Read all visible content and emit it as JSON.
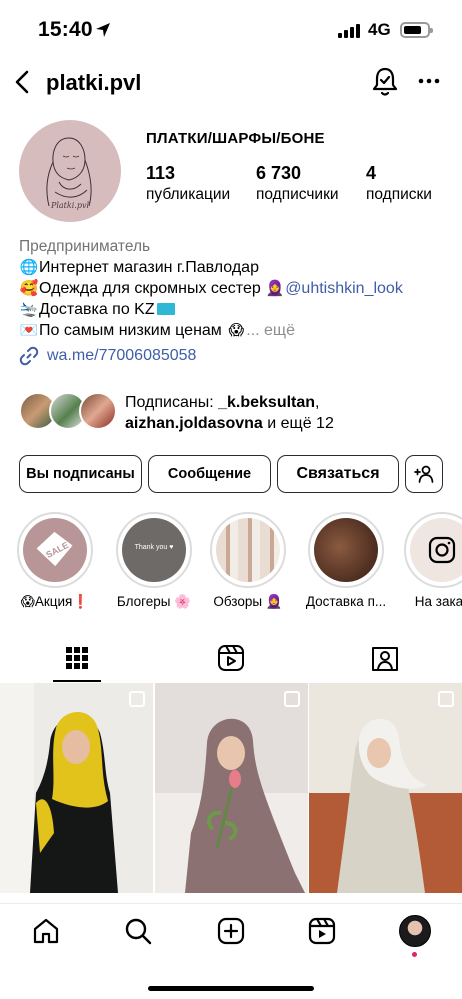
{
  "status_bar": {
    "time": "15:40",
    "network": "4G"
  },
  "header": {
    "username": "platki.pvl"
  },
  "profile": {
    "avatar_brand": "Platki.pvl",
    "full_name": "ПЛАТКИ/ШАРФЫ/БОНЕ",
    "stats": [
      {
        "value": "113",
        "label": "публикации"
      },
      {
        "value": "6 730",
        "label": "подписчики"
      },
      {
        "value": "4",
        "label": "подписки"
      }
    ],
    "category": "Предприниматель",
    "bio": {
      "line1": "Интернет магазин г.Павлодар",
      "line2": "Одежда для скромных сестер",
      "line2_mention": "@uhtishkin_look",
      "line3": "Доставка по KZ",
      "line4": "По самым низким ценам",
      "more": "... ещё"
    },
    "link": "wa.me/77006085058",
    "followed_by": {
      "prefix": "Подписаны: ",
      "user1": "_k.beksultan",
      "sep": ",",
      "user2": "aizhan.joldasovna",
      "suffix": " и ещё 12"
    }
  },
  "actions": {
    "following": "Вы подписаны",
    "message": "Сообщение",
    "contact": "Связаться"
  },
  "highlights": [
    {
      "label": "😱Акция❗",
      "cover_text": "SALE"
    },
    {
      "label": "Блогеры 🌸",
      "cover_text": "Thank you ♥"
    },
    {
      "label": "Обзоры 🧕",
      "cover_text": ""
    },
    {
      "label": "Доставка п...",
      "cover_text": ""
    },
    {
      "label": "На заказ",
      "cover_text": ""
    }
  ],
  "icons": {
    "back": "chevron-left-icon",
    "bell": "bell-check-icon",
    "more": "more-horizontal-icon",
    "add_user": "add-user-icon",
    "link": "link-icon",
    "grid": "grid-icon",
    "reels": "reels-icon",
    "tagged": "tagged-icon",
    "home": "home-icon",
    "search": "search-icon",
    "create": "create-icon",
    "reels_nav": "reels-icon",
    "profile": "profile-avatar"
  },
  "colors": {
    "link_blue": "#3f5ea8",
    "muted": "#737373",
    "notify_dot": "#e0245e"
  }
}
